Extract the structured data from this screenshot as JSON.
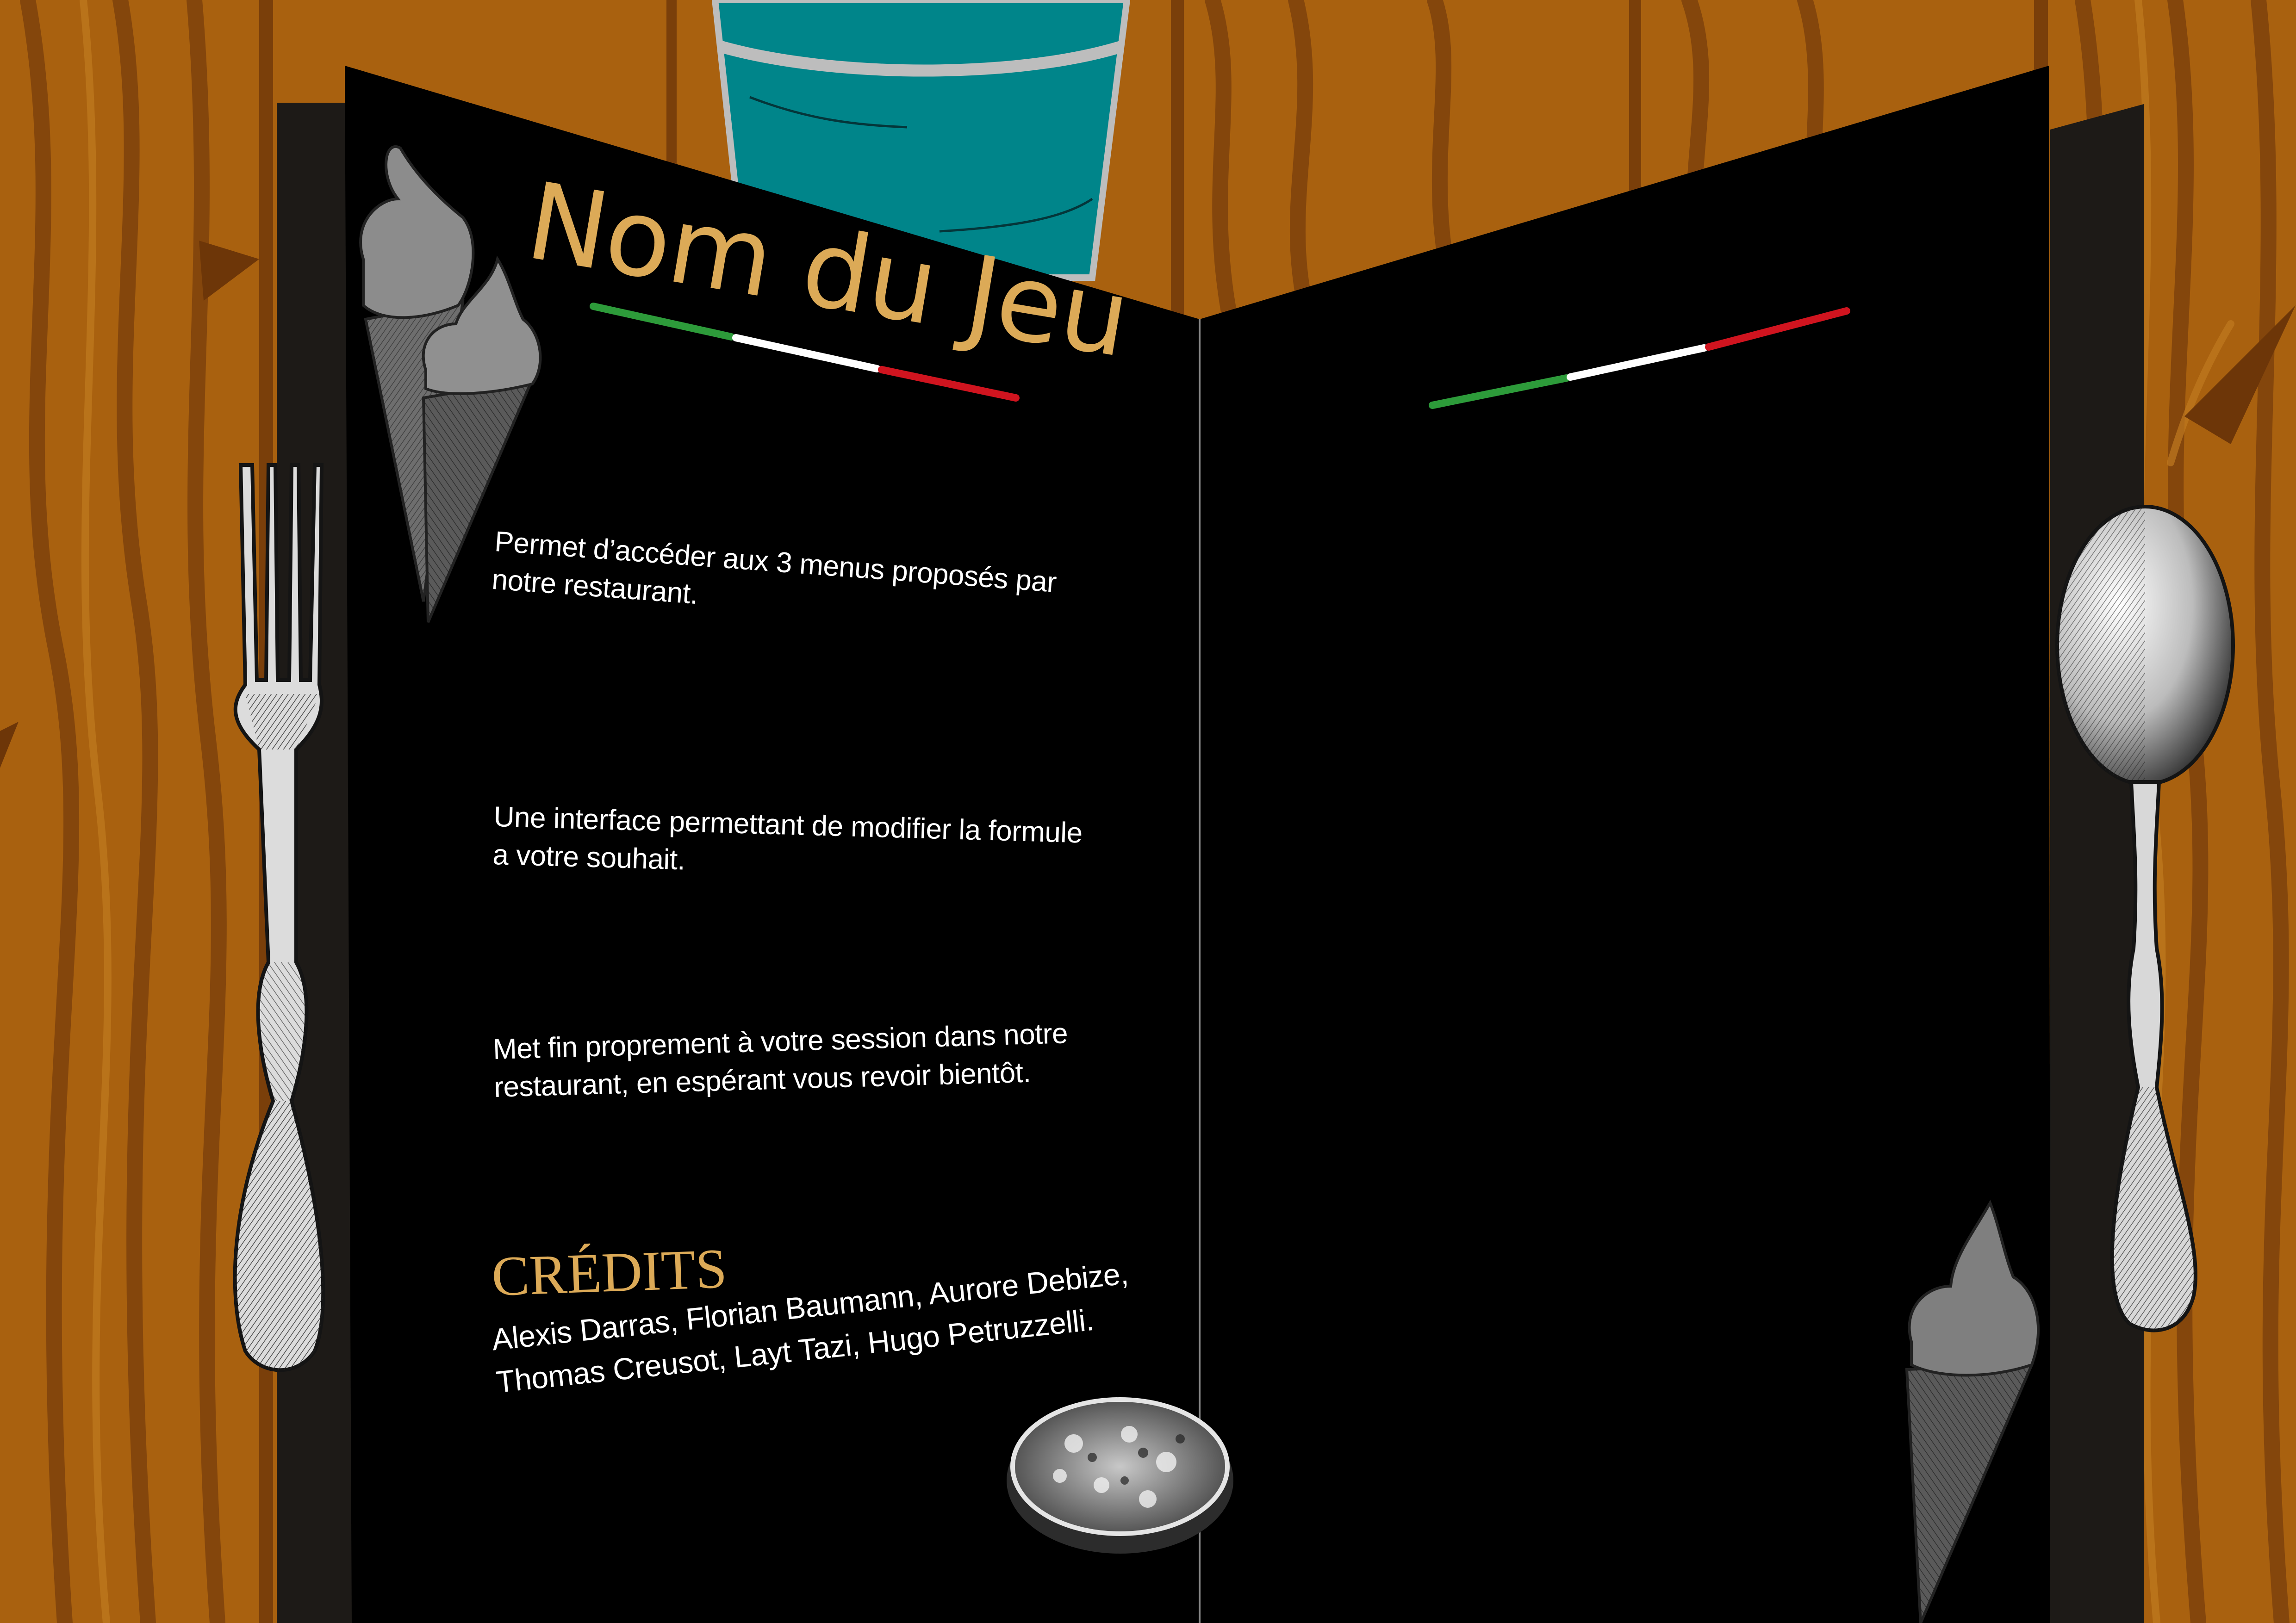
{
  "title": "Nom du Jeu",
  "menu_options": [
    {
      "lines": [
        "Permet d’accéder aux 3 menus proposés par",
        "notre restaurant."
      ]
    },
    {
      "lines": [
        "Une interface permettant de modifier la formule",
        "a votre souhait."
      ]
    },
    {
      "lines": [
        "Met fin proprement à votre session dans notre",
        "restaurant, en espérant vous revoir bientôt."
      ]
    }
  ],
  "credits": {
    "title": "CRÉDITS",
    "lines": [
      "Alexis Darras, Florian Baumann, Aurore Debize,",
      "Thomas Creusot, Layt Tazi, Hugo Petruzzelli."
    ]
  },
  "colors": {
    "wood": "#a9610f",
    "menu_black": "#000000",
    "gold": "#dcaa57",
    "teal_cup": "#00858a",
    "italy_green": "#2d9b3a",
    "italy_white": "#ffffff",
    "italy_red": "#d0141f"
  },
  "icons": {
    "decorations": [
      "ice-cream-icon",
      "fork-icon",
      "spoon-icon",
      "pizza-icon",
      "cup-icon"
    ]
  }
}
